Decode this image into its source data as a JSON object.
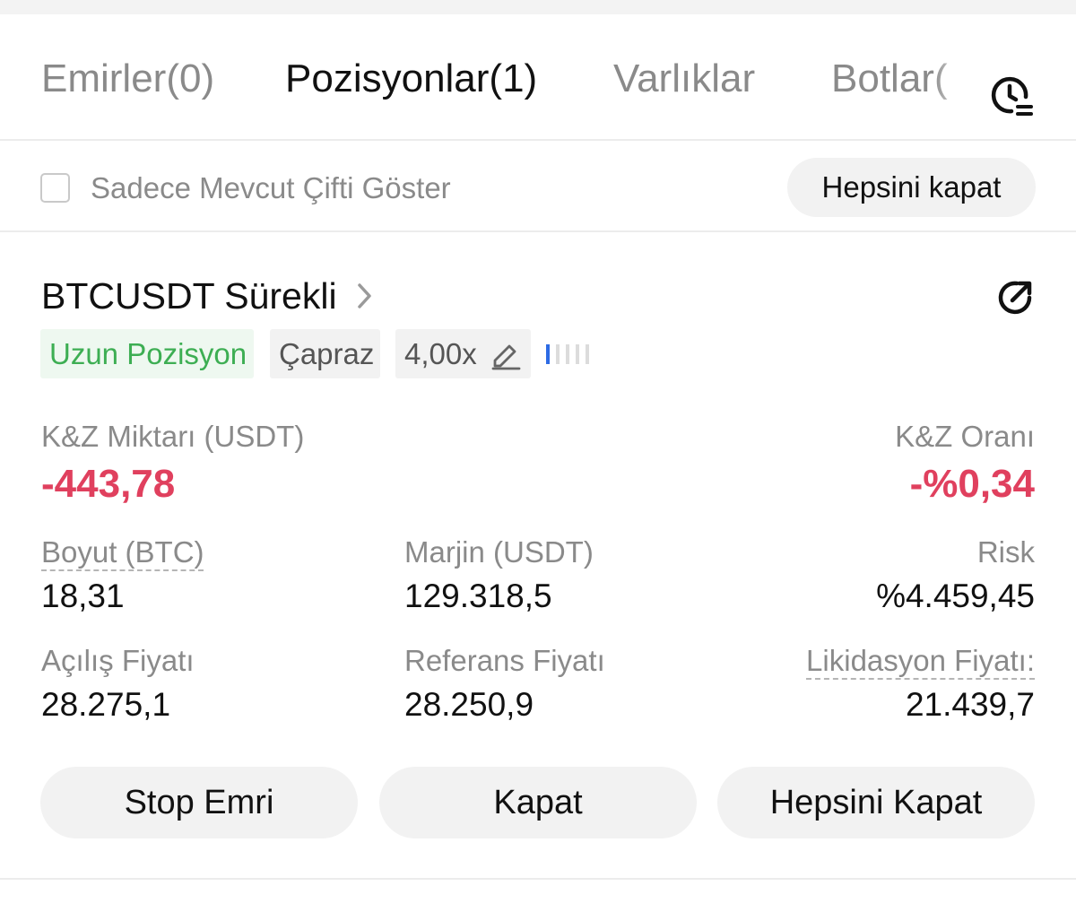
{
  "tabs": [
    {
      "label": "Emirler(0)",
      "active": false
    },
    {
      "label": "Pozisyonlar(1)",
      "active": true
    },
    {
      "label": "Varlıklar",
      "active": false
    },
    {
      "label": "Botlar(",
      "active": false
    }
  ],
  "filter": {
    "label": "Sadece Mevcut Çifti Göster",
    "checked": false,
    "close_all_label": "Hepsini kapat"
  },
  "position": {
    "title": "BTCUSDT Sürekli",
    "tags": {
      "side": "Uzun Pozisyon",
      "margin_mode": "Çapraz",
      "leverage": "4,00x"
    },
    "risk_level_bars": {
      "filled": 1,
      "total": 5
    },
    "pnl": {
      "amount_label": "K&Z Miktarı (USDT)",
      "amount_value": "-443,78",
      "ratio_label": "K&Z Oranı",
      "ratio_value": "-%0,34"
    },
    "stats": {
      "size_label": "Boyut (BTC)",
      "size_value": "18,31",
      "margin_label": "Marjin (USDT)",
      "margin_value": "129.318,5",
      "risk_label": "Risk",
      "risk_value": "%4.459,45",
      "entry_label": "Açılış Fiyatı",
      "entry_value": "28.275,1",
      "mark_label": "Referans Fiyatı",
      "mark_value": "28.250,9",
      "liq_label": "Likidasyon Fiyatı:",
      "liq_value": "21.439,7"
    },
    "actions": {
      "stop": "Stop Emri",
      "close": "Kapat",
      "close_all": "Hepsini Kapat"
    }
  },
  "colors": {
    "loss": "#e0405e",
    "long": "#3dae53",
    "long_bg": "#eef8f0",
    "risk_bar": "#2d6be4"
  }
}
